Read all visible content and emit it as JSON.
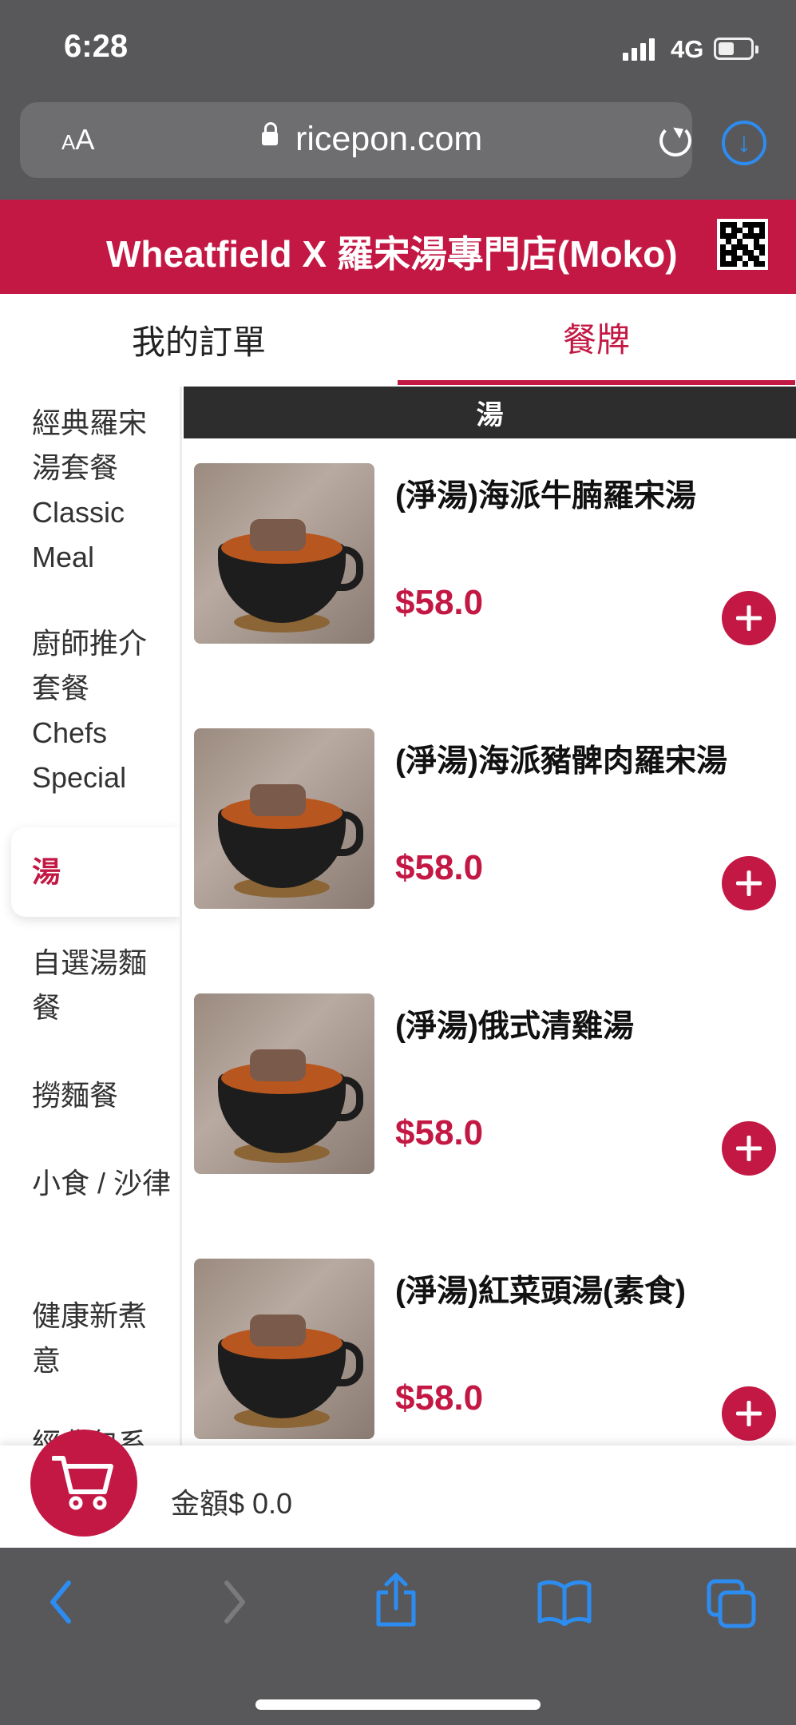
{
  "status_bar": {
    "time": "6:28",
    "network": "4G"
  },
  "browser": {
    "aa_small": "A",
    "aa_large": "A",
    "domain": "ricepon.com"
  },
  "header": {
    "title": "Wheatfield X 羅宋湯專門店(Moko)"
  },
  "tabs": [
    {
      "label": "我的訂單",
      "active": false
    },
    {
      "label": "餐牌",
      "active": true
    }
  ],
  "categories": [
    {
      "label": "經典羅宋湯套餐 Classic Meal"
    },
    {
      "label": "廚師推介套餐 Chefs Special"
    },
    {
      "label": "湯",
      "active": true
    },
    {
      "label": "自選湯麵餐"
    },
    {
      "label": "撈麵餐"
    },
    {
      "label": "小食 / 沙律"
    },
    {
      "label": "健康新煮意"
    },
    {
      "label": "經典包系"
    }
  ],
  "section": {
    "title": "湯"
  },
  "items": [
    {
      "name": "(淨湯)海派牛腩羅宋湯",
      "price": "$58.0"
    },
    {
      "name": "(淨湯)海派豬髀肉羅宋湯",
      "price": "$58.0"
    },
    {
      "name": "(淨湯)俄式清雞湯",
      "price": "$58.0"
    },
    {
      "name": "(淨湯)紅菜頭湯(素食)",
      "price": "$58.0"
    }
  ],
  "cart": {
    "total_label": "金額$ 0.0"
  },
  "colors": {
    "brand": "#c31844",
    "chrome": "#58585a",
    "link_blue": "#2d8cf0"
  },
  "icons": [
    "back-arrow-icon",
    "forward-arrow-icon",
    "share-icon",
    "bookmarks-icon",
    "tabs-icon",
    "cart-icon",
    "qr-code-icon",
    "reload-icon",
    "download-icon",
    "lock-icon",
    "add-icon"
  ]
}
